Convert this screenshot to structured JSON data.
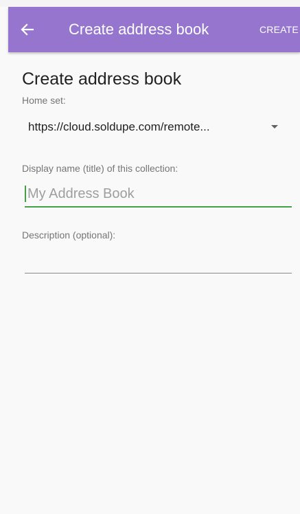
{
  "app_bar": {
    "back_icon": "arrow-left-icon",
    "title": "Create address book",
    "create_action": "CREATE"
  },
  "page": {
    "heading": "Create address book"
  },
  "form": {
    "home_set": {
      "label": "Home set:",
      "selected_value": "https://cloud.soldupe.com/remote...",
      "dropdown_icon": "dropdown-arrow-icon"
    },
    "display_name": {
      "label": "Display name (title) of this collection:",
      "value": "",
      "placeholder": "My Address Book"
    },
    "description": {
      "label": "Description (optional):",
      "value": ""
    }
  },
  "colors": {
    "app_bar": "#9575cd",
    "accent_focus": "#43a047",
    "background": "#f9f9f9"
  }
}
